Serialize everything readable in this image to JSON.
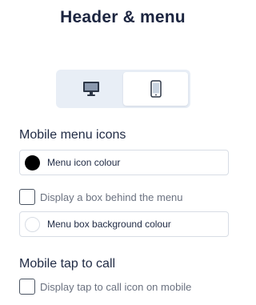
{
  "header": {
    "title": "Header & menu"
  },
  "device_toggle": {
    "options": [
      {
        "name": "desktop",
        "icon": "desktop-monitor-icon",
        "selected": false
      },
      {
        "name": "mobile",
        "icon": "mobile-phone-icon",
        "selected": true
      }
    ]
  },
  "mobile_menu_icons": {
    "title": "Mobile menu icons",
    "menu_icon_colour": {
      "label": "Menu icon colour",
      "color": "#000000"
    },
    "display_box": {
      "label": "Display a box behind the menu",
      "checked": false
    },
    "menu_box_bg": {
      "label": "Menu box background colour",
      "color": "#ffffff"
    }
  },
  "mobile_tap_to_call": {
    "title": "Mobile tap to call",
    "display_icon": {
      "label": "Display tap to call icon on mobile",
      "checked": false
    }
  },
  "colors": {
    "accent_bg": "#e8eef6",
    "text": "#1f2a44",
    "muted_text": "#6b7280"
  }
}
